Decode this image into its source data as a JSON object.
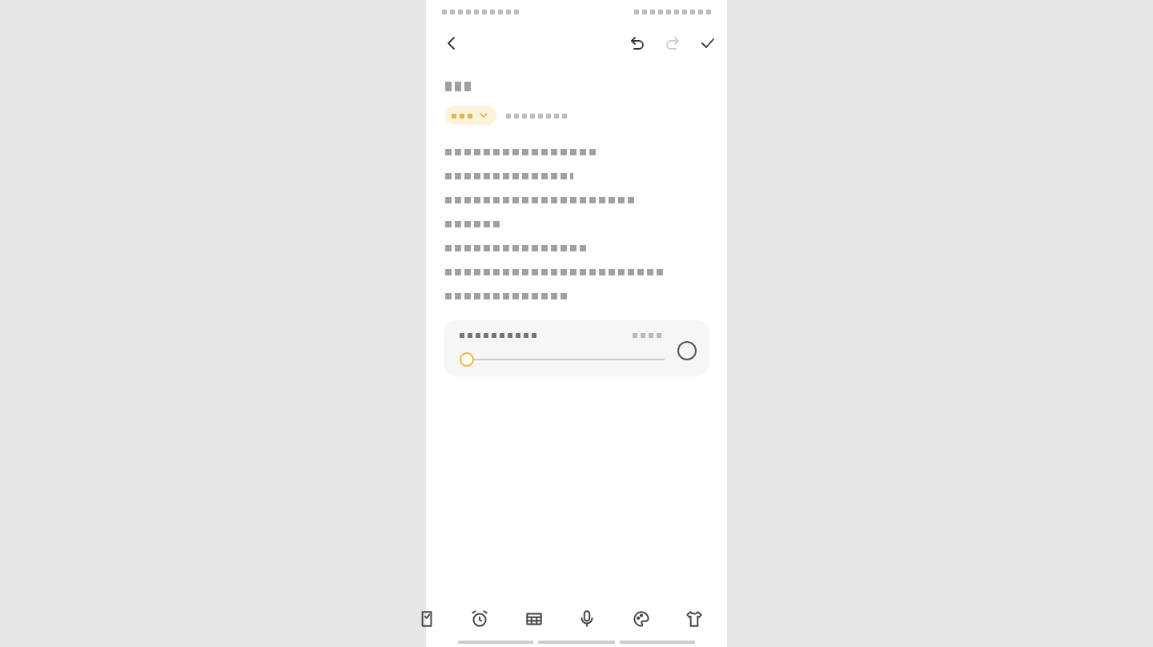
{
  "nav": {
    "undo": {
      "disabled": false
    },
    "redo": {
      "disabled": true
    }
  },
  "audio_player": {
    "level": 0
  },
  "toolbar": [
    {
      "kind": "checklist"
    },
    {
      "kind": "alarm"
    },
    {
      "kind": "table"
    },
    {
      "kind": "microphone"
    },
    {
      "kind": "palette"
    },
    {
      "kind": "shirt"
    }
  ]
}
